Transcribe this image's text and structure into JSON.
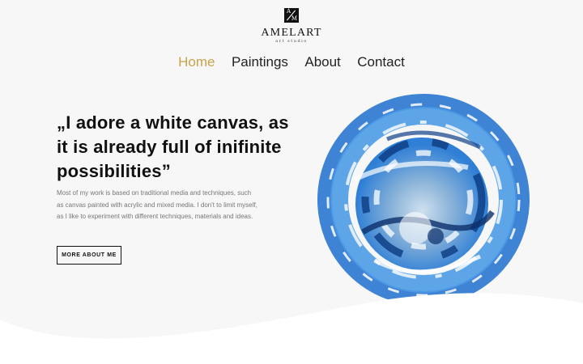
{
  "logo": {
    "mark_top": "A",
    "mark_bottom": "M",
    "name": "AMELART",
    "subtitle": "art studio",
    "icon": "amelart-logo-icon"
  },
  "nav": {
    "items": [
      {
        "label": "Home",
        "active": true
      },
      {
        "label": "Paintings",
        "active": false
      },
      {
        "label": "About",
        "active": false
      },
      {
        "label": "Contact",
        "active": false
      }
    ]
  },
  "hero": {
    "title": "„I adore a white canvas, as it is already full of inifinite possibilities”",
    "text": "Most of my work is based on traditional media and techniques, such as canvas painted with acrylic and mixed media. I don't to limit myself, as I like to experiment with different techniques, materials and ideas.",
    "button_label": "MORE ABOUT ME",
    "image": "blue-circle-painting"
  },
  "colors": {
    "accent": "#c9a24a",
    "text": "#111111",
    "muted": "#777777",
    "background": "#f7f7f7",
    "paint_blue": "#2f7fd6"
  }
}
